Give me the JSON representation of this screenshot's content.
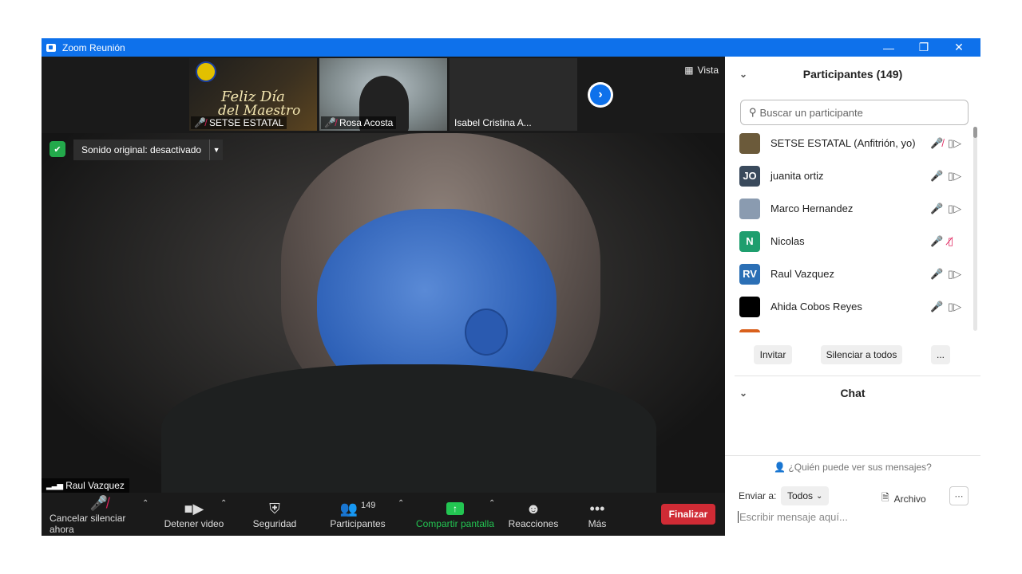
{
  "window": {
    "title": "Zoom Reunión"
  },
  "gallery": {
    "thumbs": [
      {
        "name": "SETSE ESTATAL",
        "muted": true,
        "banner": [
          "Feliz Día",
          "del Maestro"
        ]
      },
      {
        "name": "Rosa Acosta",
        "muted": true
      },
      {
        "name": "Isabel Cristina A...",
        "muted": false
      }
    ],
    "view_label": "Vista"
  },
  "video": {
    "sound_label": "Sonido original: desactivado",
    "speaker_name": "Raul Vazquez"
  },
  "toolbar": {
    "mute_label": "Cancelar silenciar ahora",
    "video_label": "Detener video",
    "security_label": "Seguridad",
    "participants_label": "Participantes",
    "participants_count": "149",
    "share_label": "Compartir pantalla",
    "reactions_label": "Reacciones",
    "more_label": "Más",
    "end_label": "Finalizar"
  },
  "participants_panel": {
    "title": "Participantes (149)",
    "search_placeholder": "Buscar un participante",
    "items": [
      {
        "name": "SETSE ESTATAL (Anfitrión, yo)",
        "initials": "",
        "color": "#6b5a3a",
        "mic_muted": true,
        "cam_off": false
      },
      {
        "name": "juanita ortiz",
        "initials": "JO",
        "color": "#3a4a5c",
        "mic_muted": false,
        "cam_off": false
      },
      {
        "name": "Marco Hernandez",
        "initials": "",
        "color": "#8a9bb0",
        "mic_muted": false,
        "cam_off": false
      },
      {
        "name": "Nicolas",
        "initials": "N",
        "color": "#1e9e6e",
        "mic_muted": false,
        "cam_off": true
      },
      {
        "name": "Raul Vazquez",
        "initials": "RV",
        "color": "#2b6fb5",
        "mic_muted": false,
        "cam_off": false
      },
      {
        "name": "Ahida Cobos Reyes",
        "initials": "",
        "color": "#000000",
        "mic_muted": false,
        "cam_off": false
      },
      {
        "name": "",
        "initials": "",
        "color": "#d9601c",
        "mic_muted": false,
        "cam_off": false
      }
    ],
    "invite_label": "Invitar",
    "mute_all_label": "Silenciar a todos",
    "more_label": "..."
  },
  "chat_panel": {
    "title": "Chat",
    "who_can_see": "¿Quién puede ver sus mensajes?",
    "send_to_label": "Enviar a:",
    "recipient": "Todos",
    "file_label": "Archivo",
    "input_placeholder": "Escribir mensaje aquí..."
  }
}
